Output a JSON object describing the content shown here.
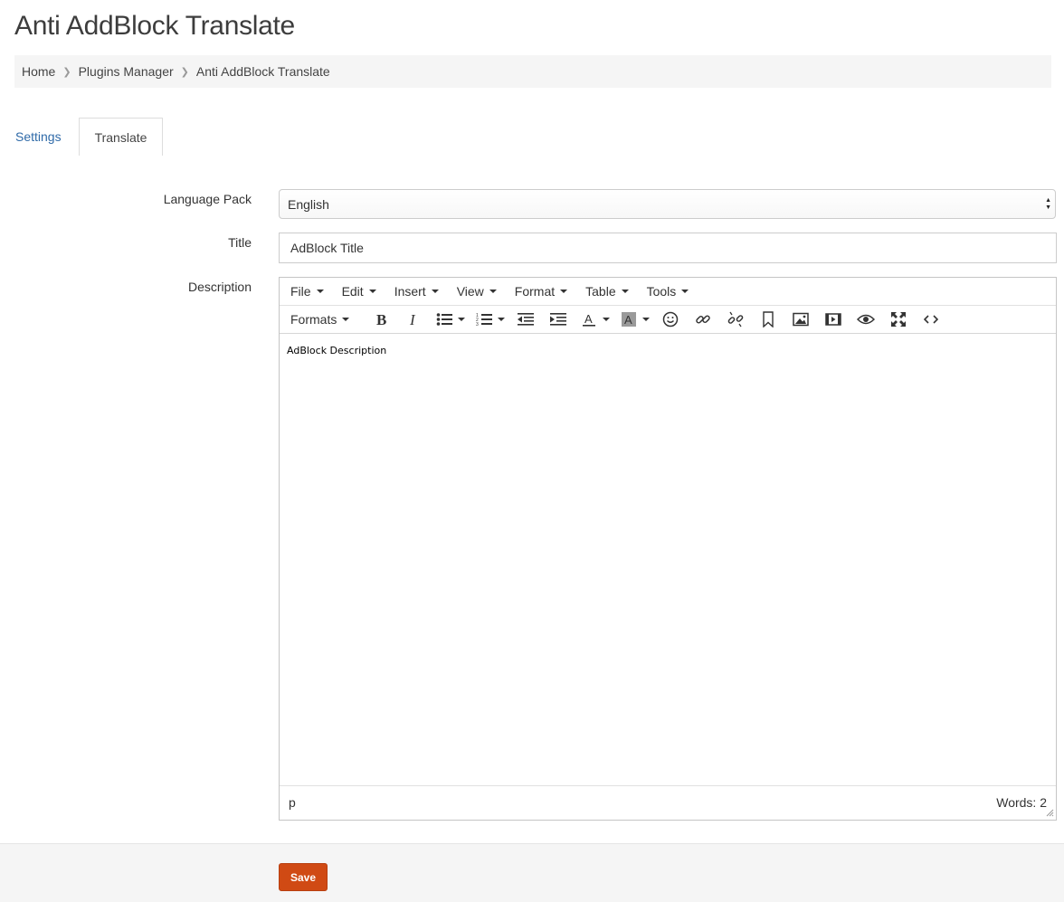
{
  "page": {
    "title": "Anti AddBlock Translate"
  },
  "breadcrumb": [
    "Home",
    "Plugins Manager",
    "Anti AddBlock Translate"
  ],
  "tabs": {
    "settings": "Settings",
    "translate": "Translate"
  },
  "form": {
    "language_label": "Language Pack",
    "language_value": "English",
    "title_label": "Title",
    "title_value": "AdBlock Title",
    "description_label": "Description"
  },
  "editor": {
    "menus": [
      "File",
      "Edit",
      "Insert",
      "View",
      "Format",
      "Table",
      "Tools"
    ],
    "formats_label": "Formats",
    "icons": [
      "bold-icon",
      "italic-icon",
      "bullet-list-icon",
      "numbered-list-icon",
      "outdent-icon",
      "indent-icon",
      "text-color-icon",
      "background-color-icon",
      "emoticons-icon",
      "link-icon",
      "unlink-icon",
      "bookmark-icon",
      "image-icon",
      "media-icon",
      "preview-icon",
      "fullscreen-icon",
      "code-icon"
    ],
    "content": "AdBlock Description",
    "status_path": "p",
    "word_count": "Words: 2"
  },
  "footer": {
    "save_label": "Save"
  },
  "colors": {
    "accent": "#d04a14",
    "link": "#2f6aa8"
  }
}
